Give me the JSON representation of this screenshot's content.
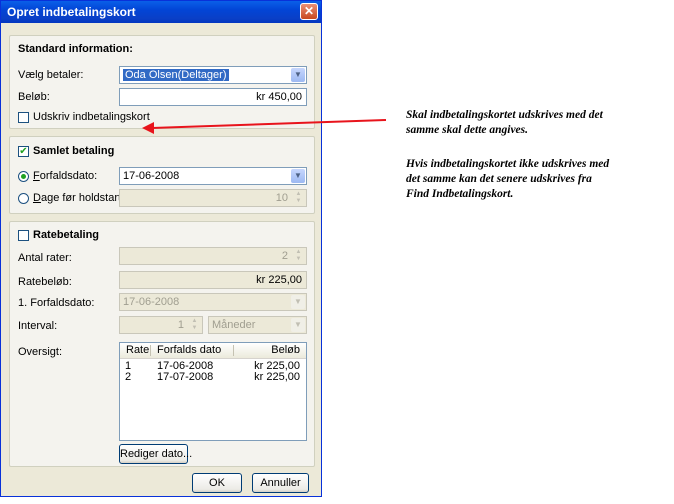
{
  "window": {
    "title": "Opret indbetalingskort",
    "close_icon": "close-icon"
  },
  "standard": {
    "heading": "Standard information:",
    "payer_label": "Vælg betaler:",
    "payer_value": "Oda Olsen(Deltager)",
    "amount_label": "Beløb:",
    "amount_value": "kr 450,00",
    "print_label": "Udskriv indbetalingskort",
    "print_checked": false
  },
  "samlet": {
    "heading": "Samlet betaling",
    "checked": true,
    "due_key": "F",
    "due_rest": "orfaldsdato:",
    "due_value": "17-06-2008",
    "days_key": "D",
    "days_rest": "age før holdstart:",
    "days_value": "10"
  },
  "rate": {
    "heading": "Ratebetaling",
    "checked": false,
    "count_label": "Antal rater:",
    "count_value": "2",
    "amount_label": "Ratebeløb:",
    "amount_value": "kr 225,00",
    "first_due_label": "1. Forfaldsdato:",
    "first_due_value": "17-06-2008",
    "interval_label": "Interval:",
    "interval_value": "1",
    "interval_unit": "Måneder",
    "overview_label": "Oversigt:",
    "columns": [
      "Rate",
      "Forfalds dato",
      "Beløb"
    ],
    "rows": [
      {
        "rate": "1",
        "date": "17-06-2008",
        "amount": "kr 225,00"
      },
      {
        "rate": "2",
        "date": "17-07-2008",
        "amount": "kr 225,00"
      }
    ],
    "edit_button": "Rediger dato..."
  },
  "buttons": {
    "ok": "OK",
    "cancel": "Annuller"
  },
  "annotations": {
    "para1_line1": "Skal indbetalingskortet udskrives med det",
    "para1_line2": "samme skal dette angives.",
    "para2_line1": "Hvis indbetalingskortet ikke udskrives med",
    "para2_line2": "det samme kan det senere udskrives fra",
    "para2_line3": "Find Indbetalingskort.",
    "arrow_color": "#e8141c"
  }
}
